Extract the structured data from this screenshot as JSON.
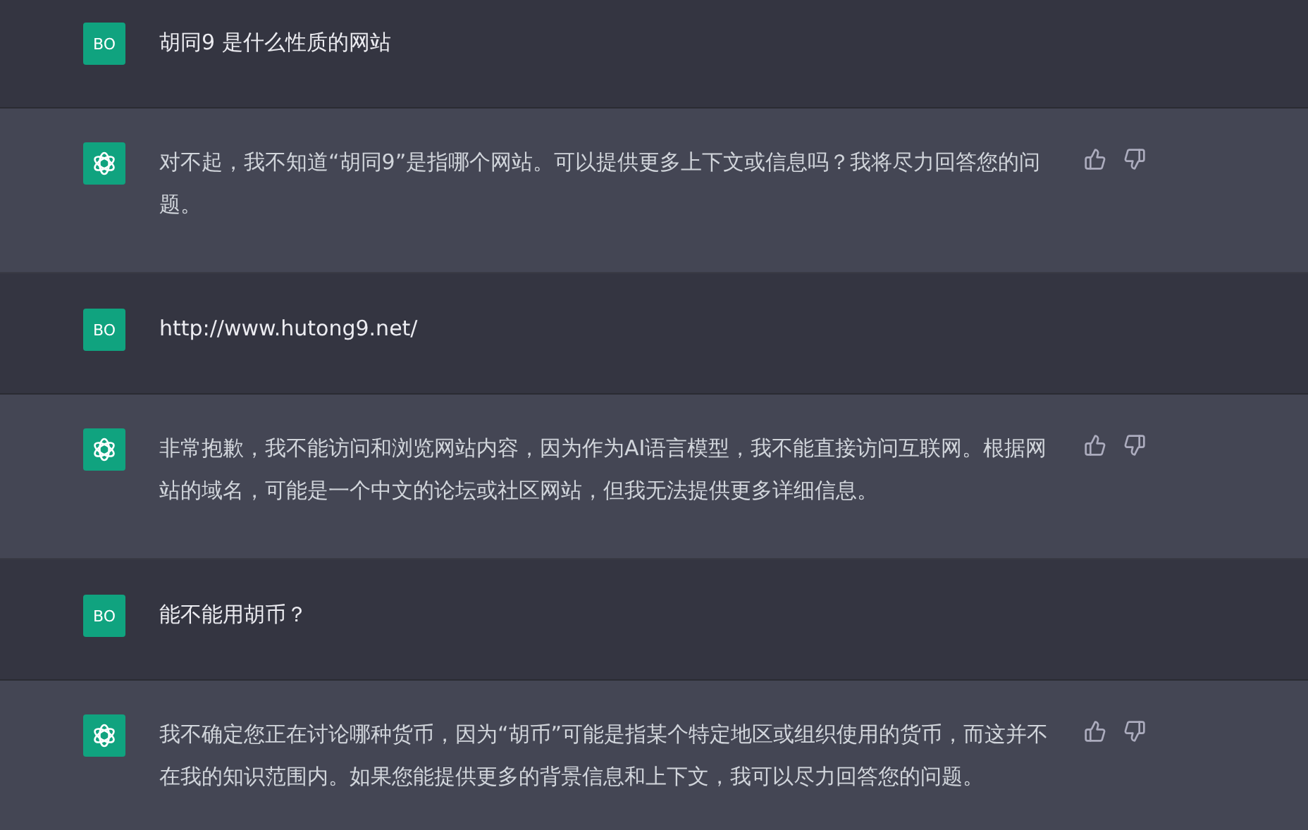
{
  "messages": [
    {
      "kind": "user",
      "avatar": "BO",
      "text": "胡同9 是什么性质的网站"
    },
    {
      "kind": "assistant",
      "text": "对不起，我不知道“胡同9”是指哪个网站。可以提供更多上下文或信息吗？我将尽力回答您的问题。"
    },
    {
      "kind": "user",
      "avatar": "BO",
      "text": "http://www.hutong9.net/"
    },
    {
      "kind": "assistant",
      "text": "非常抱歉，我不能访问和浏览网站内容，因为作为AI语言模型，我不能直接访问互联网。根据网站的域名，可能是一个中文的论坛或社区网站，但我无法提供更多详细信息。"
    },
    {
      "kind": "user",
      "avatar": "BO",
      "text": "能不能用胡币？"
    },
    {
      "kind": "assistant",
      "text": "我不确定您正在讨论哪种货币，因为“胡币”可能是指某个特定地区或组织使用的货币，而这并不在我的知识范围内。如果您能提供更多的背景信息和上下文，我可以尽力回答您的问题。"
    }
  ]
}
